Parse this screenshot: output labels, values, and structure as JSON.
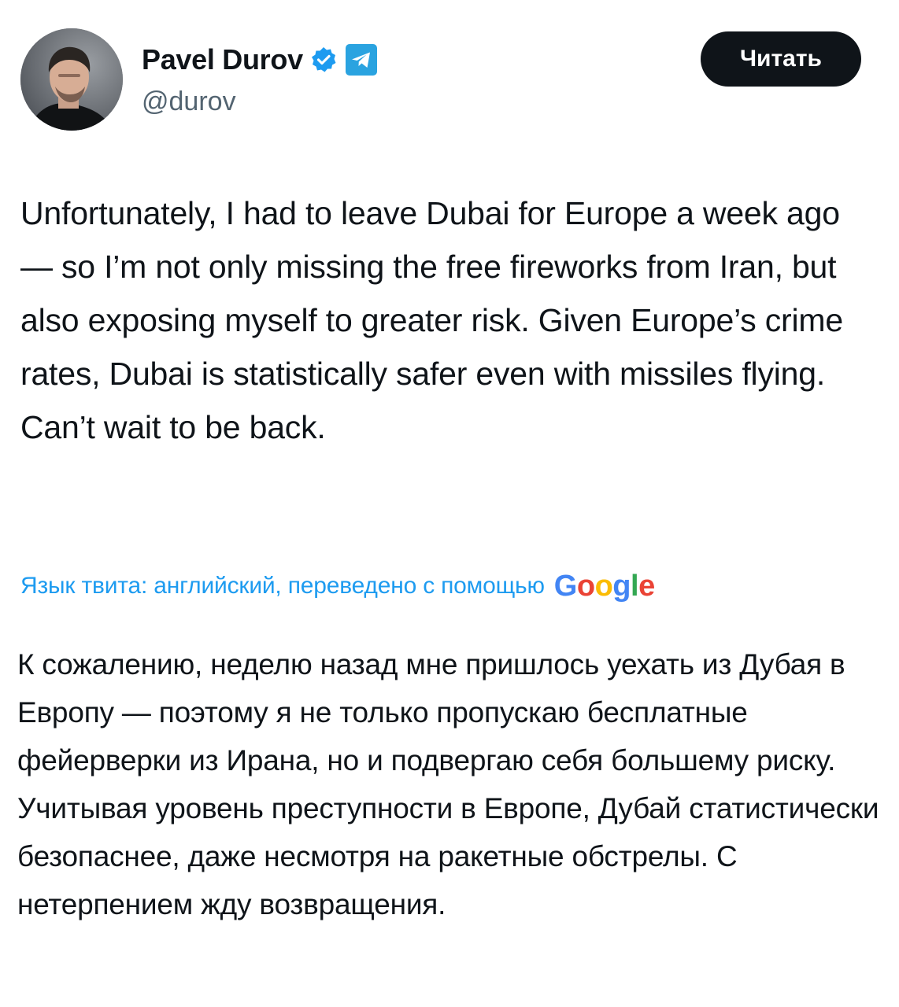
{
  "author": {
    "name": "Pavel Durov",
    "handle": "@durov",
    "avatar": "profile-photo",
    "verified_icon": "verified-check-icon",
    "affiliate_icon": "telegram-icon"
  },
  "header": {
    "read_button_label": "Читать"
  },
  "tweet": {
    "text": "Unfortunately, I had to leave Dubai for Europe a week ago — so I’m not only missing the free fireworks from Iran, but also exposing myself to greater risk. Given Europe’s crime rates, Dubai is statistically safer even with missiles flying. Can’t wait to be back."
  },
  "translation": {
    "note": "Язык твита: английский, переведено с помощью",
    "provider_logo": "Google",
    "text": "К сожалению, неделю назад мне пришлось уехать из Дубая в Европу — поэтому я не только пропускаю бесплатные фейерверки из Ирана, но и подвергаю себя большему риску. Учитывая уровень преступности в Европе, Дубай статистически безопаснее, даже несмотря на ракетные обстрелы. С нетерпением жду возвращения."
  },
  "colors": {
    "text": "#0f1419",
    "secondary": "#536471",
    "link": "#1d9bf0",
    "button_bg": "#0f1419",
    "button_text": "#ffffff",
    "verified": "#1d9bf0",
    "telegram": "#2aa3e0"
  }
}
